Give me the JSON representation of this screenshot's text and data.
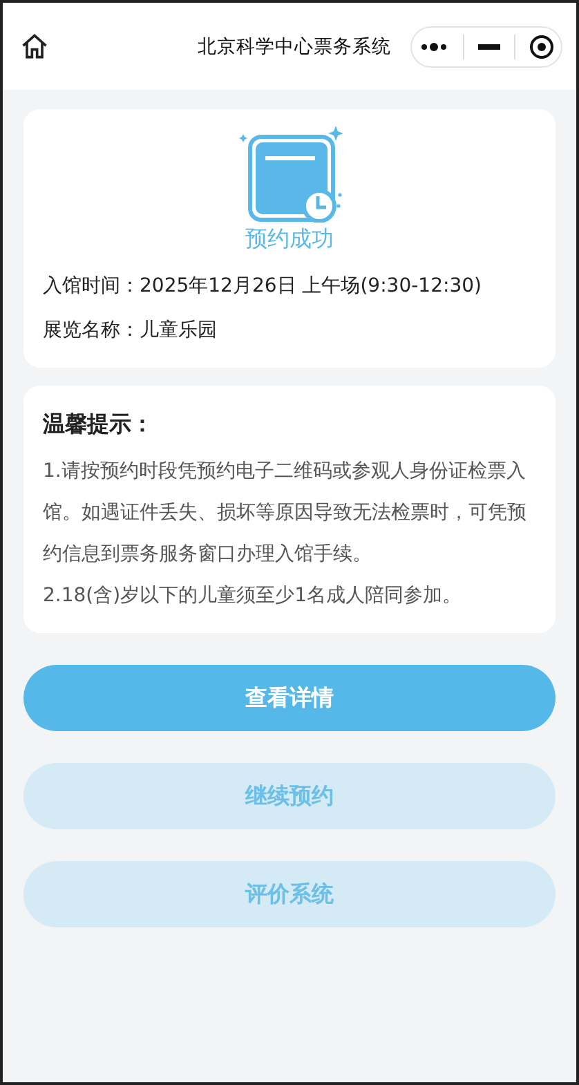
{
  "nav": {
    "title": "北京科学中心票务系统"
  },
  "result": {
    "status": "预约成功",
    "fields": [
      {
        "label": "入馆时间：",
        "value": "2025年12月26日 上午场(9:30-12:30)"
      },
      {
        "label": "展览名称：",
        "value": "儿童乐园"
      }
    ]
  },
  "tips": {
    "title": "温馨提示：",
    "items": [
      "1.请按预约时段凭预约电子二维码或参观人身份证检票入馆。如遇证件丢失、损坏等原因导致无法检票时，可凭预约信息到票务服务窗口办理入馆手续。",
      "2.18(含)岁以下的儿童须至少1名成人陪同参加。"
    ]
  },
  "buttons": [
    {
      "label": "查看详情",
      "disabled": false
    },
    {
      "label": "继续预约",
      "disabled": true
    },
    {
      "label": "评价系统",
      "disabled": true
    }
  ]
}
